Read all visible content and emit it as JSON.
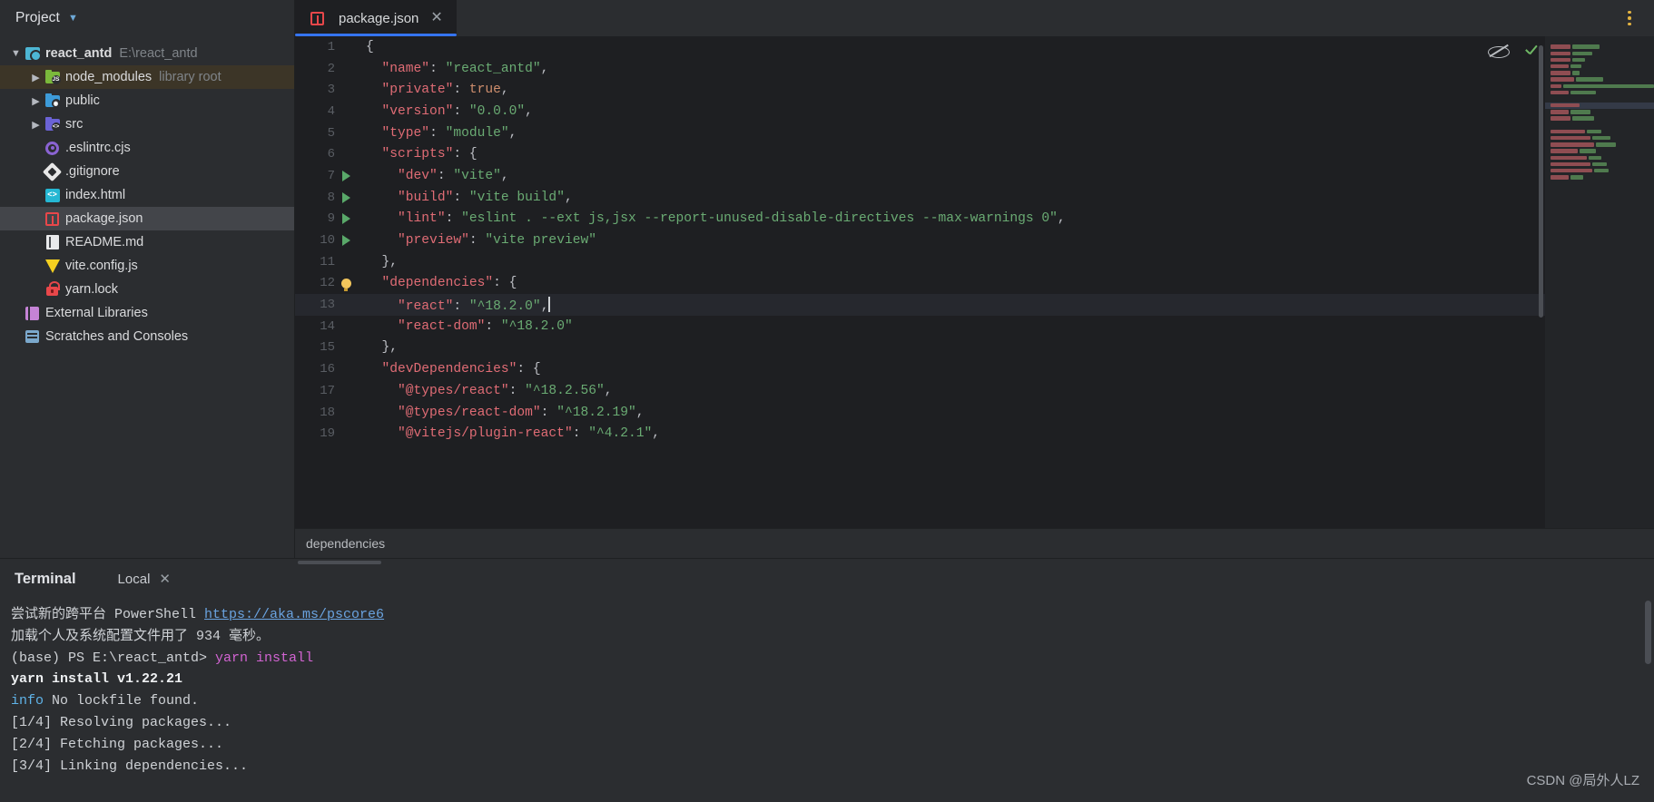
{
  "sidebar": {
    "title": "Project",
    "chevron_icon": "chevron-down-icon",
    "tree": [
      {
        "label": "react_antd",
        "sub": "E:\\react_antd",
        "icon": "module-icon",
        "arrow": "chevron-down-icon",
        "indent": 0,
        "bold": true,
        "state": "normal"
      },
      {
        "label": "node_modules",
        "sub": "library root",
        "icon": "folder-node-icon",
        "arrow": "chevron-right-icon",
        "indent": 1,
        "bold": false,
        "state": "library"
      },
      {
        "label": "public",
        "sub": "",
        "icon": "folder-public-icon",
        "arrow": "chevron-right-icon",
        "indent": 1,
        "bold": false,
        "state": "normal"
      },
      {
        "label": "src",
        "sub": "",
        "icon": "folder-source-icon",
        "arrow": "chevron-right-icon",
        "indent": 1,
        "bold": false,
        "state": "normal"
      },
      {
        "label": ".eslintrc.cjs",
        "sub": "",
        "icon": "eslint-icon",
        "arrow": "",
        "indent": 1,
        "bold": false,
        "state": "normal"
      },
      {
        "label": ".gitignore",
        "sub": "",
        "icon": "git-icon",
        "arrow": "",
        "indent": 1,
        "bold": false,
        "state": "normal"
      },
      {
        "label": "index.html",
        "sub": "",
        "icon": "html-icon",
        "arrow": "",
        "indent": 1,
        "bold": false,
        "state": "normal"
      },
      {
        "label": "package.json",
        "sub": "",
        "icon": "json-icon",
        "arrow": "",
        "indent": 1,
        "bold": false,
        "state": "selected"
      },
      {
        "label": "README.md",
        "sub": "",
        "icon": "markdown-icon",
        "arrow": "",
        "indent": 1,
        "bold": false,
        "state": "normal"
      },
      {
        "label": "vite.config.js",
        "sub": "",
        "icon": "vite-icon",
        "arrow": "",
        "indent": 1,
        "bold": false,
        "state": "normal"
      },
      {
        "label": "yarn.lock",
        "sub": "",
        "icon": "lock-icon",
        "arrow": "",
        "indent": 1,
        "bold": false,
        "state": "normal"
      },
      {
        "label": "External Libraries",
        "sub": "",
        "icon": "external-libraries-icon",
        "arrow": "",
        "indent": 0,
        "bold": false,
        "state": "normal"
      },
      {
        "label": "Scratches and Consoles",
        "sub": "",
        "icon": "scratches-icon",
        "arrow": "",
        "indent": 0,
        "bold": false,
        "state": "normal"
      }
    ]
  },
  "editor": {
    "tab": {
      "label": "package.json",
      "icon": "json-icon",
      "close_icon": "close-icon",
      "active": true
    },
    "kebab_icon": "more-options-icon",
    "inspection_eye_icon": "hide-inspections-icon",
    "inspection_status_icon": "no-problems-check-icon",
    "breadcrumb": "dependencies",
    "cursor_line": 13,
    "lines": [
      {
        "n": 1,
        "gutter": "",
        "indent": 0,
        "tokens": [
          {
            "t": "p",
            "v": "{"
          }
        ]
      },
      {
        "n": 2,
        "gutter": "",
        "indent": 1,
        "tokens": [
          {
            "t": "k",
            "v": "\"name\""
          },
          {
            "t": "p",
            "v": ": "
          },
          {
            "t": "s",
            "v": "\"react_antd\""
          },
          {
            "t": "p",
            "v": ","
          }
        ]
      },
      {
        "n": 3,
        "gutter": "",
        "indent": 1,
        "tokens": [
          {
            "t": "k",
            "v": "\"private\""
          },
          {
            "t": "p",
            "v": ": "
          },
          {
            "t": "bool",
            "v": "true"
          },
          {
            "t": "p",
            "v": ","
          }
        ]
      },
      {
        "n": 4,
        "gutter": "",
        "indent": 1,
        "tokens": [
          {
            "t": "k",
            "v": "\"version\""
          },
          {
            "t": "p",
            "v": ": "
          },
          {
            "t": "s",
            "v": "\"0.0.0\""
          },
          {
            "t": "p",
            "v": ","
          }
        ]
      },
      {
        "n": 5,
        "gutter": "",
        "indent": 1,
        "tokens": [
          {
            "t": "k",
            "v": "\"type\""
          },
          {
            "t": "p",
            "v": ": "
          },
          {
            "t": "s",
            "v": "\"module\""
          },
          {
            "t": "p",
            "v": ","
          }
        ]
      },
      {
        "n": 6,
        "gutter": "",
        "indent": 1,
        "tokens": [
          {
            "t": "k",
            "v": "\"scripts\""
          },
          {
            "t": "p",
            "v": ": {"
          }
        ]
      },
      {
        "n": 7,
        "gutter": "run",
        "indent": 2,
        "tokens": [
          {
            "t": "k",
            "v": "\"dev\""
          },
          {
            "t": "p",
            "v": ": "
          },
          {
            "t": "s",
            "v": "\"vite\""
          },
          {
            "t": "p",
            "v": ","
          }
        ]
      },
      {
        "n": 8,
        "gutter": "run",
        "indent": 2,
        "tokens": [
          {
            "t": "k",
            "v": "\"build\""
          },
          {
            "t": "p",
            "v": ": "
          },
          {
            "t": "s",
            "v": "\"vite build\""
          },
          {
            "t": "p",
            "v": ","
          }
        ]
      },
      {
        "n": 9,
        "gutter": "run",
        "indent": 2,
        "tokens": [
          {
            "t": "k",
            "v": "\"lint\""
          },
          {
            "t": "p",
            "v": ": "
          },
          {
            "t": "s",
            "v": "\"eslint . --ext js,jsx --report-unused-disable-directives --max-warnings 0\""
          },
          {
            "t": "p",
            "v": ","
          }
        ]
      },
      {
        "n": 10,
        "gutter": "run",
        "indent": 2,
        "tokens": [
          {
            "t": "k",
            "v": "\"preview\""
          },
          {
            "t": "p",
            "v": ": "
          },
          {
            "t": "s",
            "v": "\"vite preview\""
          }
        ]
      },
      {
        "n": 11,
        "gutter": "",
        "indent": 1,
        "tokens": [
          {
            "t": "p",
            "v": "},"
          }
        ]
      },
      {
        "n": 12,
        "gutter": "bulb",
        "indent": 1,
        "tokens": [
          {
            "t": "k",
            "v": "\"dependencies\""
          },
          {
            "t": "p",
            "v": ": {"
          }
        ]
      },
      {
        "n": 13,
        "gutter": "",
        "indent": 2,
        "tokens": [
          {
            "t": "k",
            "v": "\"react\""
          },
          {
            "t": "p",
            "v": ": "
          },
          {
            "t": "s",
            "v": "\"^18.2.0\""
          },
          {
            "t": "p",
            "v": ","
          },
          {
            "t": "caret",
            "v": ""
          }
        ]
      },
      {
        "n": 14,
        "gutter": "",
        "indent": 2,
        "tokens": [
          {
            "t": "k",
            "v": "\"react-dom\""
          },
          {
            "t": "p",
            "v": ": "
          },
          {
            "t": "s",
            "v": "\"^18.2.0\""
          }
        ]
      },
      {
        "n": 15,
        "gutter": "",
        "indent": 1,
        "tokens": [
          {
            "t": "p",
            "v": "},"
          }
        ]
      },
      {
        "n": 16,
        "gutter": "",
        "indent": 1,
        "tokens": [
          {
            "t": "k",
            "v": "\"devDependencies\""
          },
          {
            "t": "p",
            "v": ": {"
          }
        ]
      },
      {
        "n": 17,
        "gutter": "",
        "indent": 2,
        "tokens": [
          {
            "t": "k",
            "v": "\"@types/react\""
          },
          {
            "t": "p",
            "v": ": "
          },
          {
            "t": "s",
            "v": "\"^18.2.56\""
          },
          {
            "t": "p",
            "v": ","
          }
        ]
      },
      {
        "n": 18,
        "gutter": "",
        "indent": 2,
        "tokens": [
          {
            "t": "k",
            "v": "\"@types/react-dom\""
          },
          {
            "t": "p",
            "v": ": "
          },
          {
            "t": "s",
            "v": "\"^18.2.19\""
          },
          {
            "t": "p",
            "v": ","
          }
        ]
      },
      {
        "n": 19,
        "gutter": "",
        "indent": 2,
        "tokens": [
          {
            "t": "k",
            "v": "\"@vitejs/plugin-react\""
          },
          {
            "t": "p",
            "v": ": "
          },
          {
            "t": "s",
            "v": "\"^4.2.1\""
          },
          {
            "t": "p",
            "v": ","
          }
        ]
      }
    ],
    "minimap": [
      {
        "k": 22,
        "s": 30,
        "hl": false
      },
      {
        "k": 22,
        "s": 22,
        "hl": false
      },
      {
        "k": 22,
        "s": 14,
        "hl": false
      },
      {
        "k": 20,
        "s": 12,
        "hl": false
      },
      {
        "k": 22,
        "s": 8,
        "hl": false
      },
      {
        "k": 26,
        "s": 30,
        "hl": false
      },
      {
        "k": 26,
        "s": 210,
        "hl": false
      },
      {
        "k": 20,
        "s": 28,
        "hl": false
      },
      {
        "k": 0,
        "s": 0,
        "hl": false
      },
      {
        "k": 32,
        "s": 0,
        "hl": true
      },
      {
        "k": 20,
        "s": 22,
        "hl": false
      },
      {
        "k": 22,
        "s": 24,
        "hl": false
      },
      {
        "k": 0,
        "s": 0,
        "hl": false
      },
      {
        "k": 38,
        "s": 16,
        "hl": false
      },
      {
        "k": 44,
        "s": 20,
        "hl": false
      },
      {
        "k": 48,
        "s": 22,
        "hl": false
      },
      {
        "k": 30,
        "s": 18,
        "hl": false
      },
      {
        "k": 40,
        "s": 14,
        "hl": false
      },
      {
        "k": 44,
        "s": 16,
        "hl": false
      },
      {
        "k": 46,
        "s": 16,
        "hl": false
      },
      {
        "k": 20,
        "s": 14,
        "hl": false
      }
    ]
  },
  "terminal": {
    "title": "Terminal",
    "tab_label": "Local",
    "tab_close_icon": "close-icon",
    "lines": [
      [
        {
          "t": "dim",
          "v": "尝试新的跨平台 PowerShell "
        },
        {
          "t": "link",
          "v": "https://aka.ms/pscore6"
        }
      ],
      [
        {
          "t": "dim",
          "v": ""
        }
      ],
      [
        {
          "t": "dim",
          "v": "加载个人及系统配置文件用了 934 毫秒。"
        }
      ],
      [
        {
          "t": "dim",
          "v": "(base) PS E:\\react_antd> "
        },
        {
          "t": "magenta",
          "v": "yarn install"
        }
      ],
      [
        {
          "t": "bold",
          "v": "yarn install v1.22.21"
        }
      ],
      [
        {
          "t": "info",
          "v": "info"
        },
        {
          "t": "dim",
          "v": " No lockfile found."
        }
      ],
      [
        {
          "t": "dim",
          "v": "[1/4] Resolving packages..."
        }
      ],
      [
        {
          "t": "dim",
          "v": "[2/4] Fetching packages..."
        }
      ],
      [
        {
          "t": "dim",
          "v": "[3/4] Linking dependencies..."
        }
      ]
    ]
  },
  "watermark": "CSDN @局外人LZ",
  "colors": {
    "accent_blue": "#3574f0",
    "key_red": "#e06c75",
    "string_green": "#6aab73",
    "bool_orange": "#cf8e6d",
    "terminal_magenta": "#d264d2",
    "link_blue": "#6aa3e0",
    "selection_grey": "#43454a",
    "library_yellow": "#3c3527"
  }
}
